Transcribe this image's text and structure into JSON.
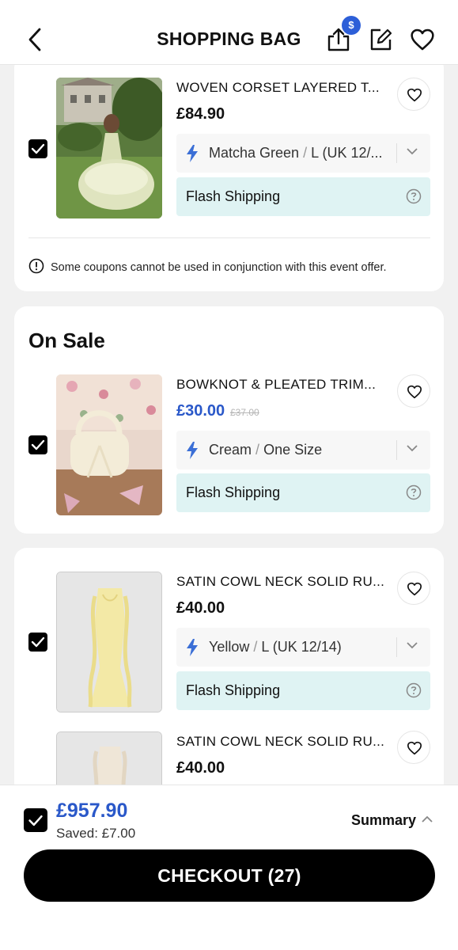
{
  "header": {
    "title": "SHOPPING BAG",
    "share_badge": "$"
  },
  "items": [
    {
      "name": "WOVEN CORSET LAYERED T...",
      "price": "£84.90",
      "variant_color": "Matcha Green",
      "variant_size": "L (UK 12/...",
      "shipping": "Flash Shipping",
      "checked": true,
      "image": "woman in green tiered dress on lawn"
    },
    {
      "name": "BOWKNOT & PLEATED TRIM...",
      "price": "£30.00",
      "old_price": "£37.00",
      "variant_color": "Cream",
      "variant_size": "One Size",
      "shipping": "Flash Shipping",
      "checked": true,
      "image": "cream ruffle handbag on floral backdrop"
    },
    {
      "name": "SATIN COWL NECK SOLID RU...",
      "price": "£40.00",
      "variant_color": "Yellow",
      "variant_size": "L (UK 12/14)",
      "shipping": "Flash Shipping",
      "checked": true,
      "image": "yellow satin ruffle maxi dress"
    },
    {
      "name": "SATIN COWL NECK SOLID RU...",
      "price": "£40.00",
      "image": "champagne satin dress"
    }
  ],
  "notice": "Some coupons cannot be used in conjunction with this event offer.",
  "sale_section_title": "On Sale",
  "variant_separator": "/",
  "footer": {
    "total": "£957.90",
    "saved": "Saved: £7.00",
    "summary_label": "Summary",
    "checkout_label": "CHECKOUT (27)"
  },
  "colors": {
    "accent_blue": "#2a58c9",
    "shipping_bg": "#dff3f3",
    "checkout_bg": "#000000"
  }
}
